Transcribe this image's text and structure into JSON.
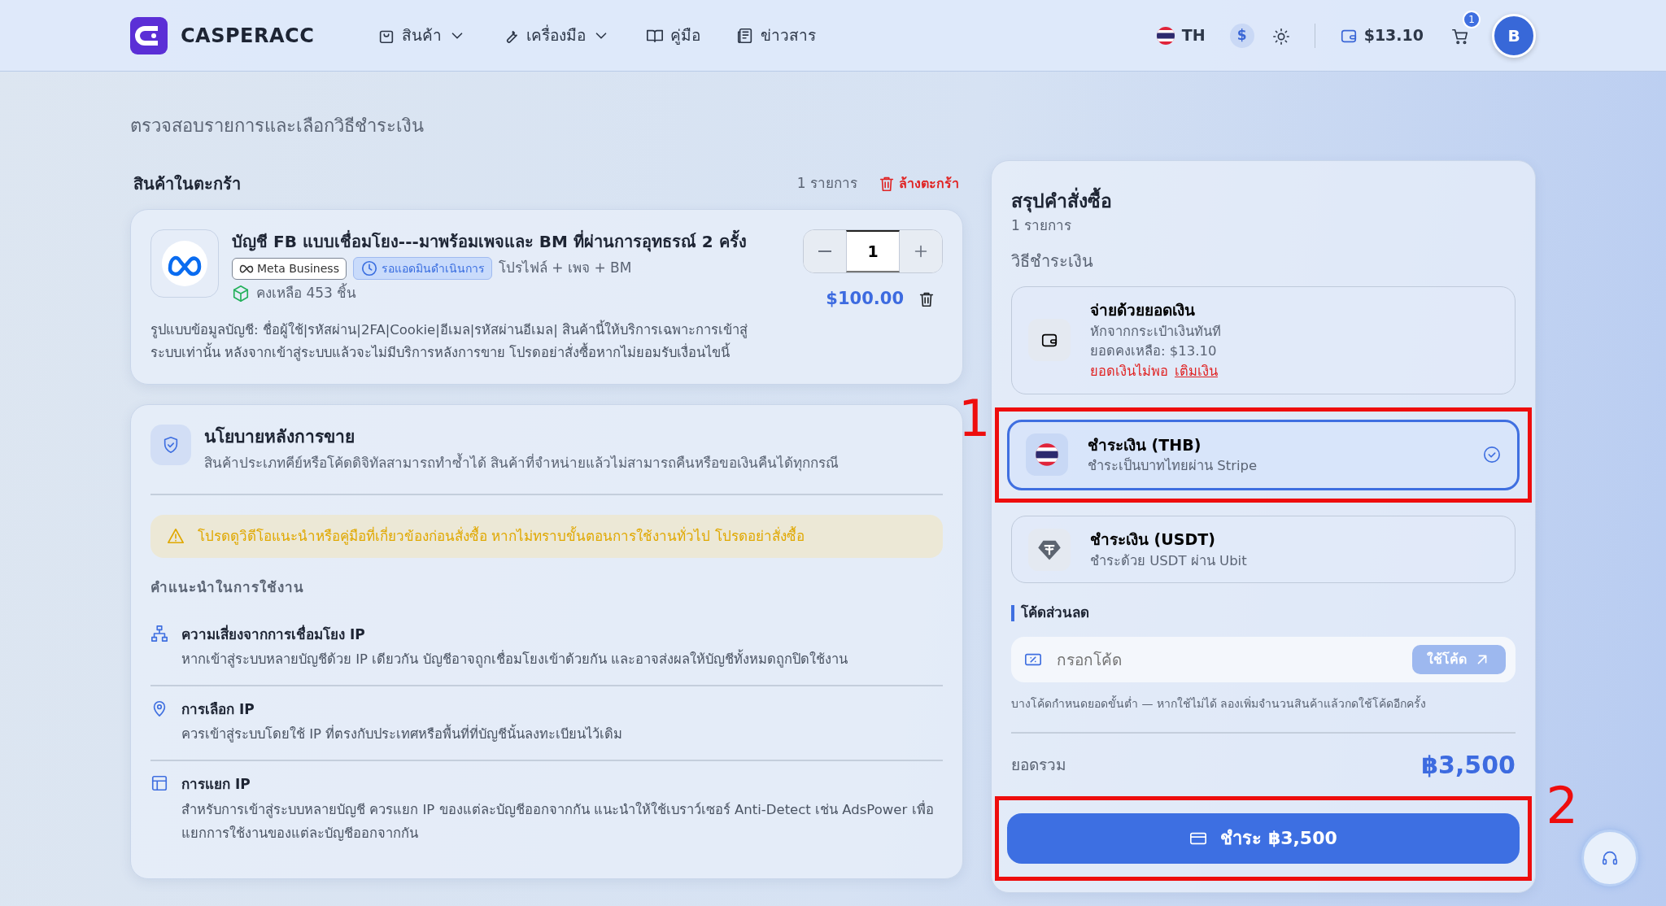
{
  "nav": {
    "brand": "CASPERACC",
    "links": [
      {
        "label": "สินค้า",
        "dropdown": true
      },
      {
        "label": "เครื่องมือ",
        "dropdown": true
      },
      {
        "label": "คู่มือ",
        "dropdown": false
      },
      {
        "label": "ข่าวสาร",
        "dropdown": false
      }
    ],
    "language": "TH",
    "currency": "$",
    "balance": "$13.10",
    "cart_count": "1",
    "avatar": "B"
  },
  "page": {
    "subtitle": "ตรวจสอบรายการและเลือกวิธีชำระเงิน"
  },
  "cart": {
    "title": "สินค้าในตะกร้า",
    "count": "1 รายการ",
    "clear": "ล้างตะกร้า",
    "items": [
      {
        "title": "บัญชี FB แบบเชื่อมโยง---มาพร้อมเพจและ BM ที่ผ่านการอุทธรณ์ 2 ครั้ง",
        "tag": "Meta Business",
        "status": "รอแอดมินดำเนินการ",
        "extra": "โปรไฟล์ + เพจ + BM",
        "stock": "คงเหลือ 453 ชิ้น",
        "quantity": "1",
        "price": "$100.00",
        "description": "รูปแบบข้อมูลบัญชี: ชื่อผู้ใช้|รหัสผ่าน|2FA|Cookie|อีเมล|รหัสผ่านอีเมล| สินค้านี้ให้บริการเฉพาะการเข้าสู่ระบบเท่านั้น หลังจากเข้าสู่ระบบแล้วจะไม่มีบริการหลังการขาย โปรดอย่าสั่งซื้อหากไม่ยอมรับเงื่อนไขนี้"
      }
    ]
  },
  "policy": {
    "title": "นโยบายหลังการขาย",
    "text": "สินค้าประเภทคีย์หรือโค้ดดิจิทัลสามารถทำซ้ำได้ สินค้าที่จำหน่ายแล้วไม่สามารถคืนหรือขอเงินคืนได้ทุกกรณี",
    "warning": "โปรดดูวิดีโอแนะนำหรือคู่มือที่เกี่ยวข้องก่อนสั่งซื้อ หากไม่ทราบขั้นตอนการใช้งานทั่วไป โปรดอย่าสั่งซื้อ",
    "tips_title": "คำแนะนำในการใช้งาน",
    "tips": [
      {
        "title": "ความเสี่ยงจากการเชื่อมโยง IP",
        "text": "หากเข้าสู่ระบบหลายบัญชีด้วย IP เดียวกัน บัญชีอาจถูกเชื่อมโยงเข้าด้วยกัน และอาจส่งผลให้บัญชีทั้งหมดถูกปิดใช้งาน"
      },
      {
        "title": "การเลือก IP",
        "text": "ควรเข้าสู่ระบบโดยใช้ IP ที่ตรงกับประเทศหรือพื้นที่ที่บัญชีนั้นลงทะเบียนไว้เดิม"
      },
      {
        "title": "การแยก IP",
        "text": "สำหรับการเข้าสู่ระบบหลายบัญชี ควรแยก IP ของแต่ละบัญชีออกจากกัน แนะนำให้ใช้เบราว์เซอร์ Anti-Detect เช่น AdsPower เพื่อแยกการใช้งานของแต่ละบัญชีออกจากกัน"
      }
    ]
  },
  "summary": {
    "title": "สรุปคำสั่งซื้อ",
    "count": "1 รายการ",
    "methods_title": "วิธีชำระเงิน",
    "methods": [
      {
        "kind": "wallet",
        "title": "จ่ายด้วยยอดเงิน",
        "subtitle": "หักจากกระเป๋าเงินทันที",
        "balance": "ยอดคงเหลือ: $13.10",
        "warning": "ยอดเงินไม่พอ",
        "link": "เติมเงิน",
        "selected": false
      },
      {
        "kind": "thb",
        "title": "ชำระเงิน (THB)",
        "subtitle": "ชำระเป็นบาทไทยผ่าน Stripe",
        "selected": true,
        "annotation": "1"
      },
      {
        "kind": "usdt",
        "title": "ชำระเงิน (USDT)",
        "subtitle": "ชำระด้วย USDT ผ่าน Ubit",
        "selected": false
      }
    ],
    "coupon_title": "โค้ดส่วนลด",
    "coupon_placeholder": "กรอกโค้ด",
    "coupon_button": "ใช้โค้ด",
    "coupon_hint": "บางโค้ดกำหนดยอดขั้นต่ำ — หากใช้ไม่ได้ ลองเพิ่มจำนวนสินค้าแล้วกดใช้โค้ดอีกครั้ง",
    "total_label": "ยอดรวม",
    "total": "฿3,500",
    "pay_button": "ชำระ ฿3,500",
    "pay_annotation": "2"
  }
}
